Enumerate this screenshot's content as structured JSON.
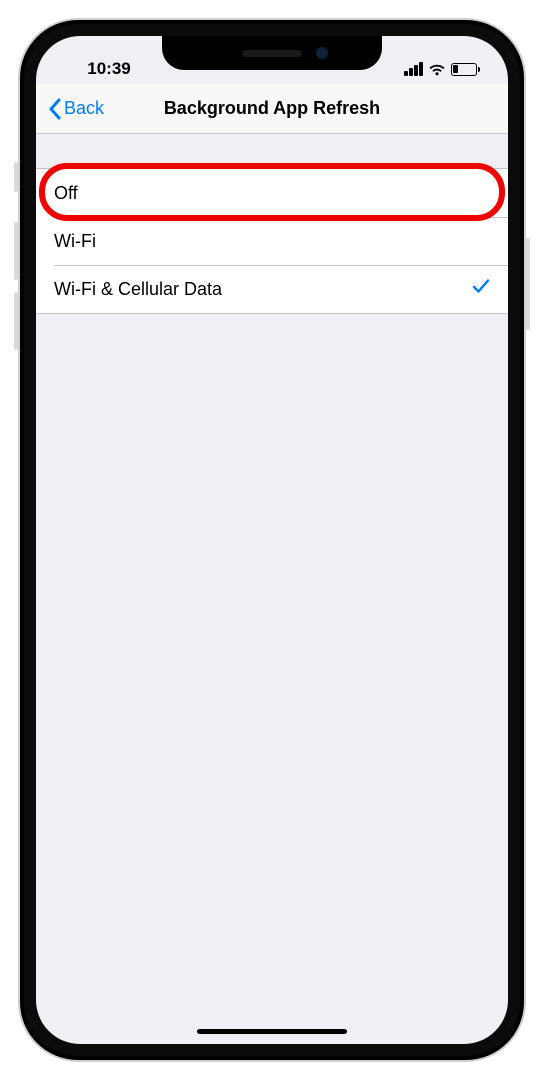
{
  "status_bar": {
    "time": "10:39"
  },
  "nav": {
    "back_label": "Back",
    "title": "Background App Refresh"
  },
  "options": [
    {
      "label": "Off",
      "selected": false,
      "highlighted": true
    },
    {
      "label": "Wi-Fi",
      "selected": false,
      "highlighted": false
    },
    {
      "label": "Wi-Fi & Cellular Data",
      "selected": true,
      "highlighted": false
    }
  ],
  "colors": {
    "ios_blue": "#007aff",
    "annotation_red": "#ee0404",
    "bg_grouped": "#efeff4",
    "separator": "#c3c3c5"
  }
}
